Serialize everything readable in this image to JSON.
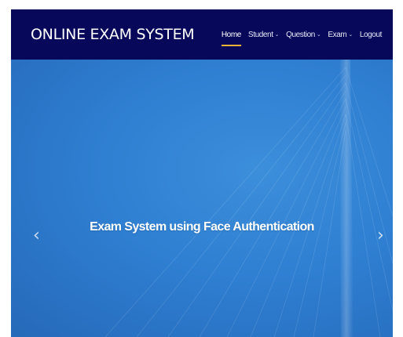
{
  "navbar": {
    "brand": "ONLINE EXAM SYSTEM",
    "menu": [
      {
        "label": "Home",
        "dropdown": false,
        "active": true
      },
      {
        "label": "Student",
        "dropdown": true,
        "active": false
      },
      {
        "label": "Question",
        "dropdown": true,
        "active": false
      },
      {
        "label": "Exam",
        "dropdown": true,
        "active": false
      },
      {
        "label": "Logout",
        "dropdown": false,
        "active": false
      }
    ],
    "dropdown_glyph": "⌄"
  },
  "hero": {
    "caption": "Exam System using Face Authentication",
    "prev_arrow": "‹",
    "next_arrow": "›"
  },
  "colors": {
    "navbar_bg": "#07085a",
    "hero_bg": "#2f7fd2",
    "active_underline": "#f2b632",
    "text": "#ffffff"
  },
  "icons": {
    "prev": "chevron-left-icon",
    "next": "chevron-right-icon",
    "dropdown": "chevron-down-icon"
  }
}
